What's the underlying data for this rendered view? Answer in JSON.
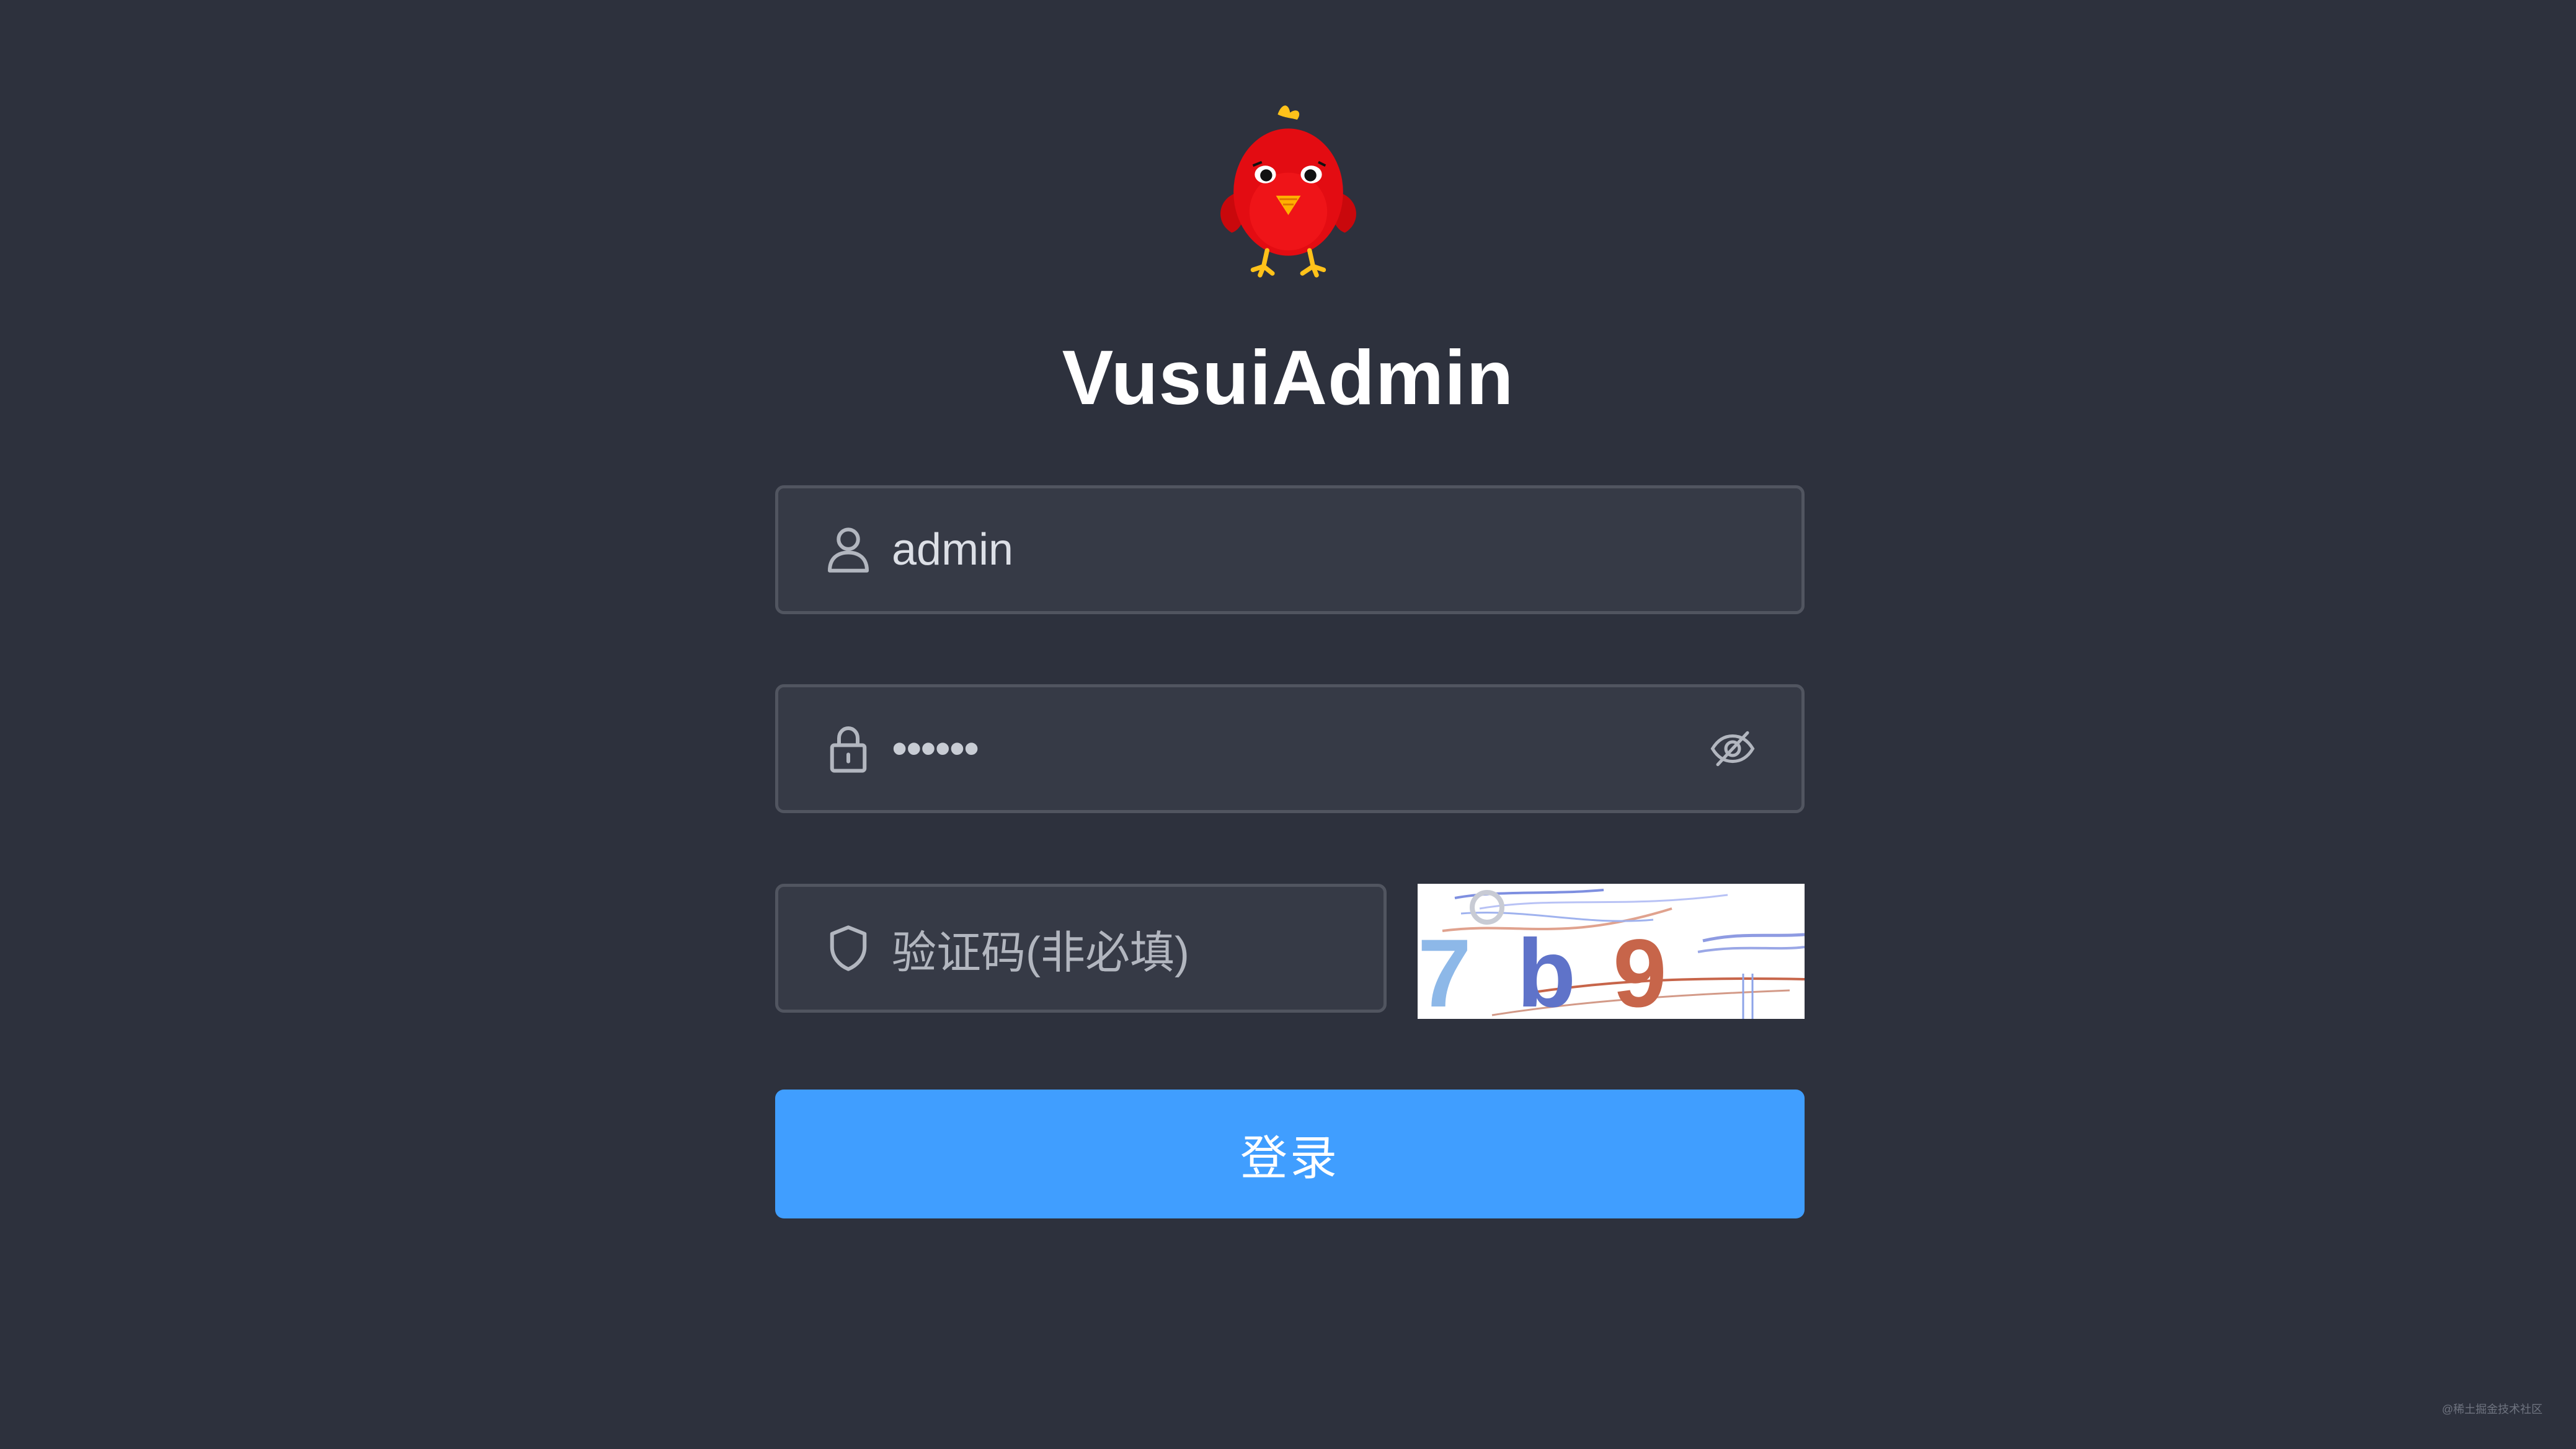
{
  "app": {
    "title": "VusuiAdmin",
    "logo_icon": "red-bird-mascot"
  },
  "form": {
    "username": {
      "value": "admin",
      "icon": "user-icon"
    },
    "password": {
      "masked_value": "••••••",
      "icon": "lock-icon",
      "toggle_icon": "eye-hidden-icon"
    },
    "captcha": {
      "placeholder": "验证码(非必填)",
      "icon": "shield-icon",
      "code_chars": [
        "7",
        "b",
        "9"
      ],
      "code_colors": [
        "#8db8e8",
        "#5f73c9",
        "#c7654a"
      ]
    },
    "login_label": "登录"
  },
  "footer": {
    "watermark": "@稀土掘金技术社区"
  },
  "colors": {
    "background": "#2d313d",
    "input_background": "#363a46",
    "input_border": "#515560",
    "primary": "#409eff"
  }
}
